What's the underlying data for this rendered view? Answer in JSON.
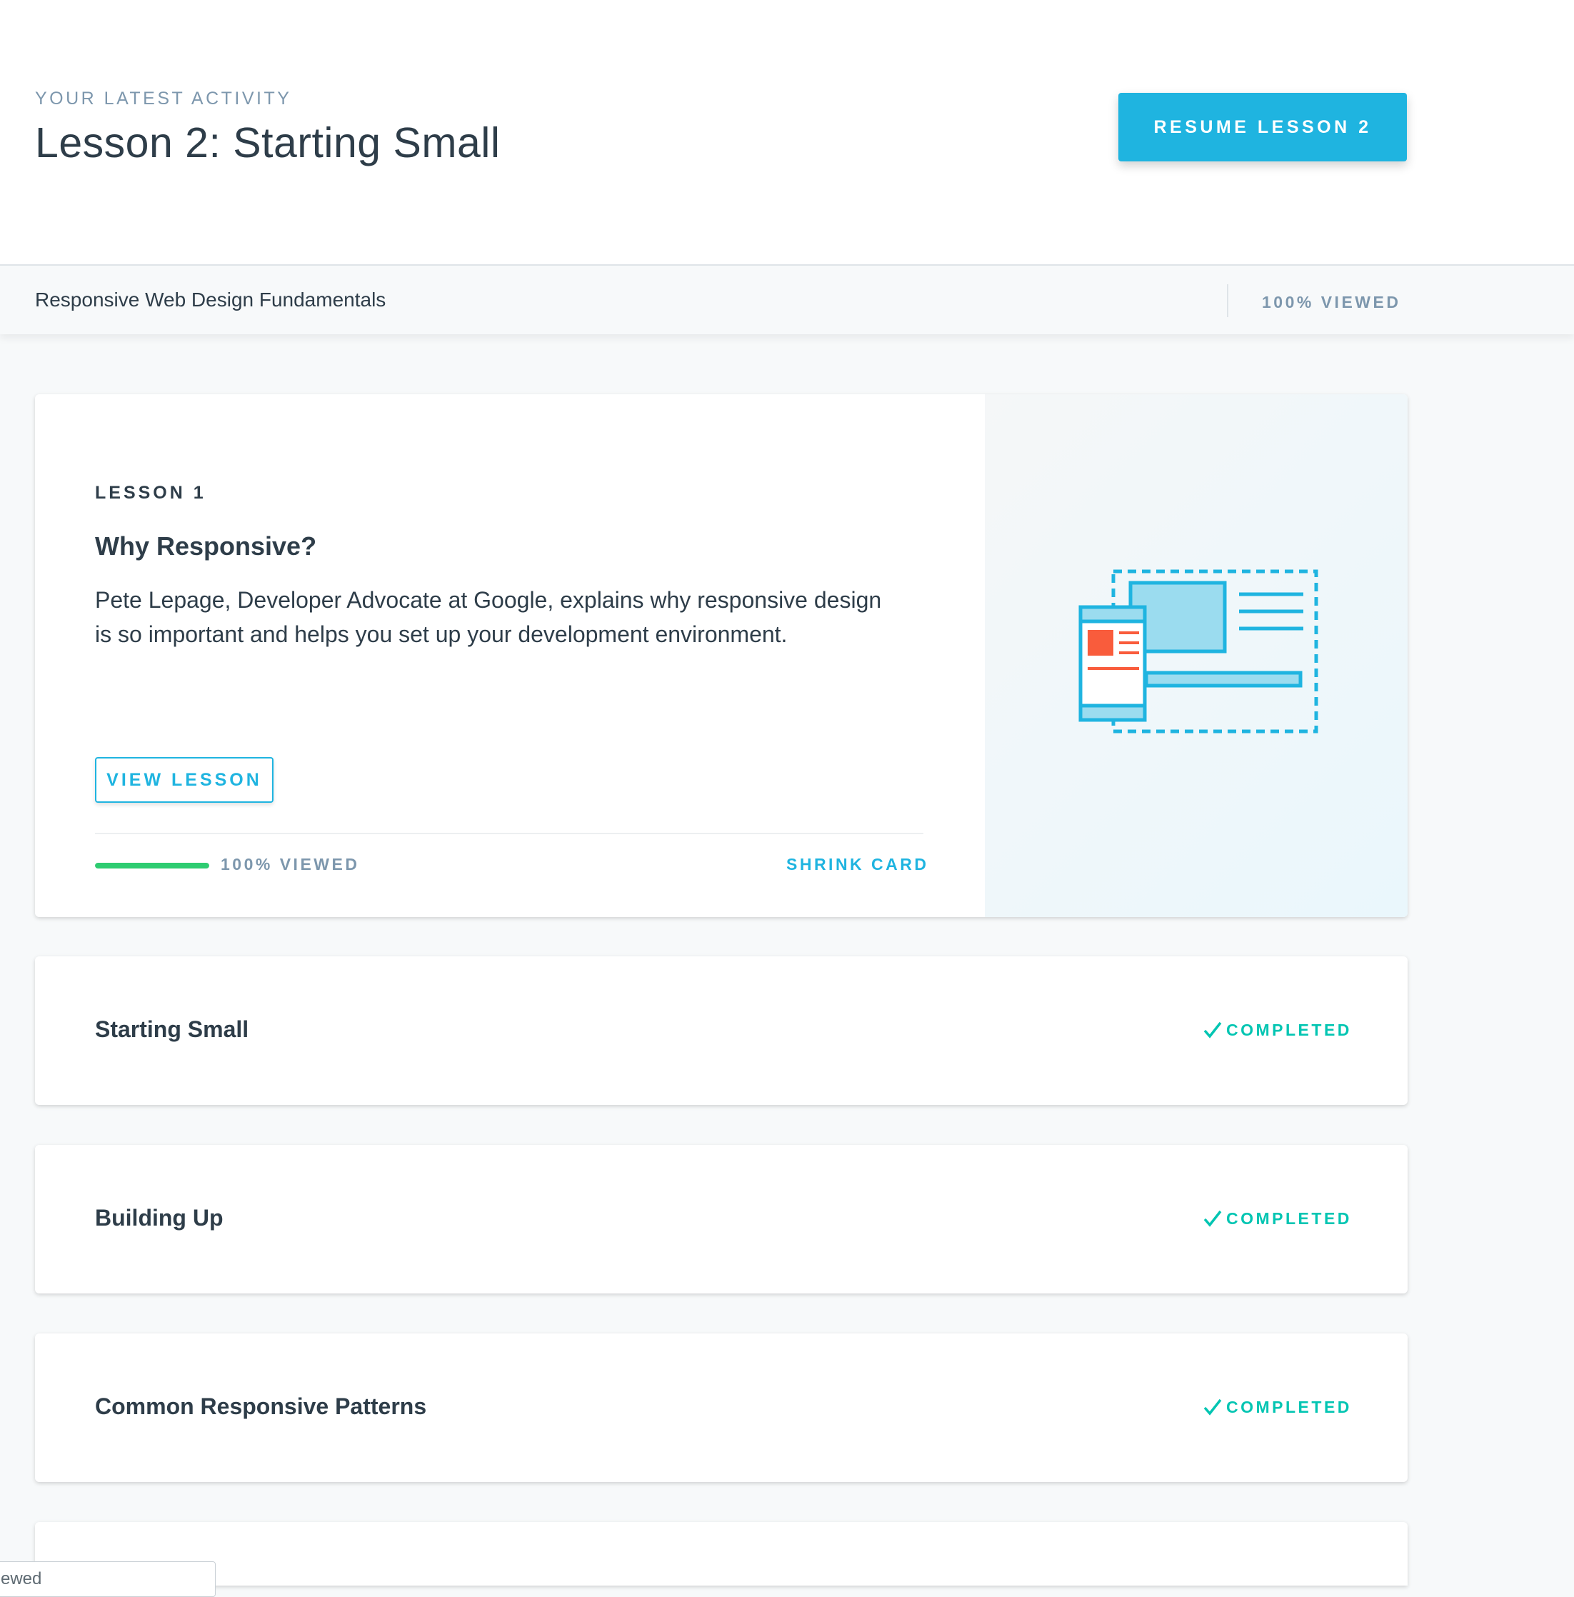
{
  "header": {
    "eyebrow": "YOUR LATEST ACTIVITY",
    "title": "Lesson 2: Starting Small",
    "resume_label": "RESUME LESSON 2"
  },
  "subheader": {
    "course_name": "Responsive Web Design Fundamentals",
    "viewed": "100% VIEWED"
  },
  "expanded_lesson": {
    "eyebrow": "LESSON 1",
    "title": "Why Responsive?",
    "description": "Pete Lepage, Developer Advocate at Google, explains why responsive design is so important and helps you set up your development environment.",
    "view_label": "VIEW LESSON",
    "progress_fraction": 1.0,
    "progress_label": "100% VIEWED",
    "shrink_label": "SHRINK CARD",
    "illustration_icon": "responsive-devices-icon"
  },
  "lessons": [
    {
      "title": "Starting Small",
      "status": "COMPLETED"
    },
    {
      "title": "Building Up",
      "status": "COMPLETED"
    },
    {
      "title": "Common Responsive Patterns",
      "status": "COMPLETED"
    }
  ],
  "tooltip": {
    "text": "ewed"
  },
  "colors": {
    "accent": "#1fb4e0",
    "progress": "#2ecc71",
    "completed": "#02c5b2",
    "muted": "#7d97ad",
    "text": "#2e3d49",
    "illustration_red": "#f95c3c"
  }
}
